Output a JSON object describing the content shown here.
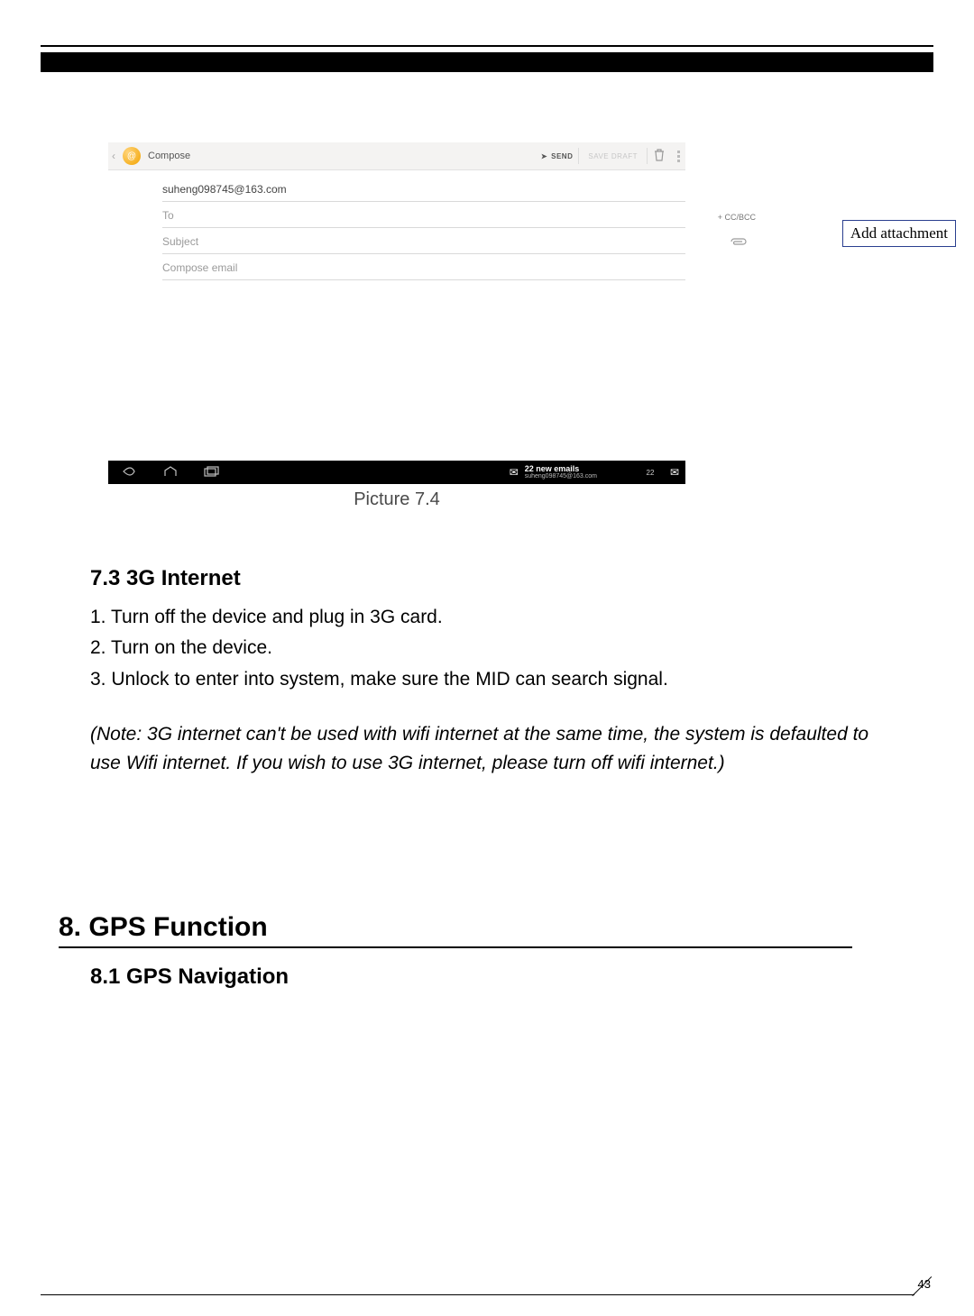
{
  "screenshot": {
    "app_label": "Compose",
    "send_label": "SEND",
    "save_draft_label": "SAVE DRAFT",
    "from_value": "suheng098745@163.com",
    "to_placeholder": "To",
    "ccbcc_label": "+ CC/BCC",
    "subject_placeholder": "Subject",
    "body_placeholder": "Compose email",
    "notif_heading": "22 new emails",
    "notif_sub": "suheng098745@163.com",
    "notif_badge": "22"
  },
  "callout_label": "Add  attachment",
  "caption": "Picture 7.4",
  "section73_heading": "7.3 3G Internet",
  "step1": "1. Turn off the device and plug in 3G card.",
  "step2": "2. Turn on the device.",
  "step3": "3. Unlock to enter into system, make sure the MID can search signal.",
  "note": "(Note: 3G internet can't be used with wifi internet at the same time, the system is defaulted to use Wifi internet. If you wish to use 3G internet, please turn off wifi internet.)",
  "section8_heading": "8. GPS Function",
  "section81_heading": "8.1 GPS Navigation",
  "page_number": "43"
}
